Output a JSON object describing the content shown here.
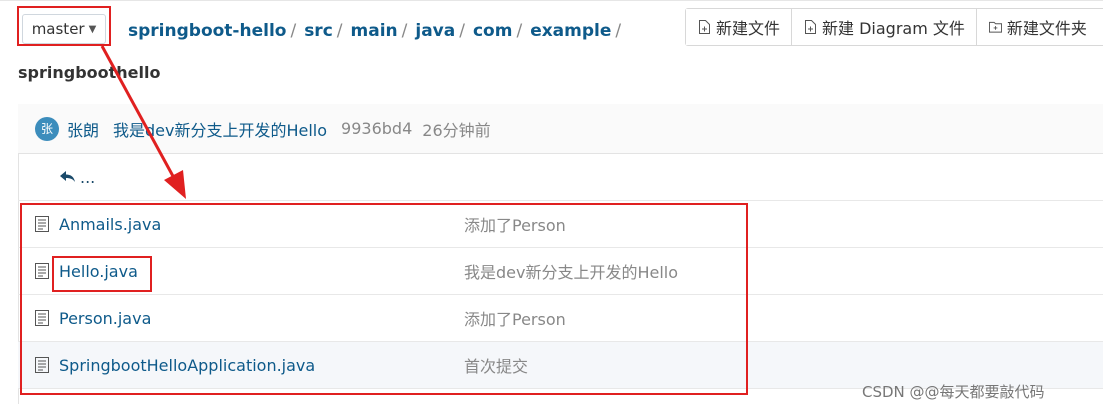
{
  "branch": {
    "label": "master"
  },
  "breadcrumb": {
    "segments": [
      "springboot-hello",
      "src",
      "main",
      "java",
      "com",
      "example"
    ],
    "separator": "/"
  },
  "toolbar": {
    "new_file": "新建文件",
    "new_diagram": "新建 Diagram 文件",
    "new_folder": "新建文件夹"
  },
  "folder_title": "springboothello",
  "commit": {
    "avatar_initial": "张",
    "author": "张朗",
    "message": "我是dev新分支上开发的Hello",
    "sha": "9936bd4",
    "time": "26分钟前"
  },
  "parent_link": "...",
  "files": [
    {
      "name": "Anmails.java",
      "message": "添加了Person"
    },
    {
      "name": "Hello.java",
      "message": "我是dev新分支上开发的Hello"
    },
    {
      "name": "Person.java",
      "message": "添加了Person"
    },
    {
      "name": "SpringbootHelloApplication.java",
      "message": "首次提交"
    }
  ],
  "watermark": "CSDN @@每天都要敲代码",
  "colors": {
    "link": "#0e5a8a",
    "annotation": "#e02020",
    "muted": "#888888"
  },
  "icons": [
    "caret-down-icon",
    "new-file-icon",
    "diagram-file-icon",
    "new-folder-icon",
    "back-arrow-icon",
    "file-text-icon"
  ]
}
